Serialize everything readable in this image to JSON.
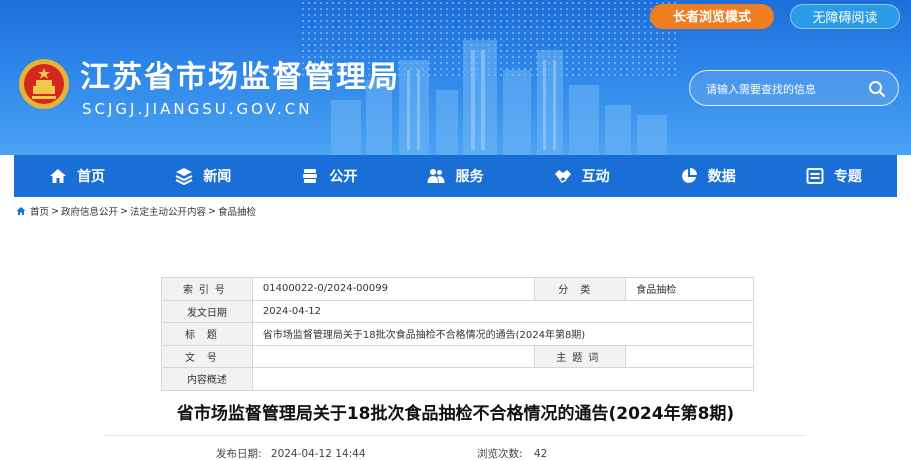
{
  "header": {
    "site_title": "江苏省市场监督管理局",
    "site_domain": "SCJGJ.JIANGSU.GOV.CN",
    "elder_mode_label": "长者浏览模式",
    "accessibility_label": "无障碍阅读",
    "search_placeholder": "请输入需要查找的信息"
  },
  "nav": {
    "items": [
      {
        "label": "首页",
        "icon": "home-icon"
      },
      {
        "label": "新闻",
        "icon": "layers-icon"
      },
      {
        "label": "公开",
        "icon": "stack-icon"
      },
      {
        "label": "服务",
        "icon": "users-icon"
      },
      {
        "label": "互动",
        "icon": "handshake-icon"
      },
      {
        "label": "数据",
        "icon": "pie-chart-icon"
      },
      {
        "label": "专题",
        "icon": "board-icon"
      }
    ]
  },
  "breadcrumb": {
    "items": [
      "首页",
      "政府信息公开",
      "法定主动公开内容",
      "食品抽检"
    ],
    "separator": ">"
  },
  "info_table": {
    "index_label": "索引号",
    "index_value": "01400022-0/2024-00099",
    "category_label": "分类",
    "category_value": "食品抽检",
    "date_label": "发文日期",
    "date_value": "2024-04-12",
    "title_label": "标题",
    "title_value": "省市场监督管理局关于18批次食品抽检不合格情况的通告(2024年第8期)",
    "doc_no_label": "文号",
    "doc_no_value": "",
    "keywords_label": "主题词",
    "keywords_value": "",
    "summary_label": "内容概述",
    "summary_value": ""
  },
  "article": {
    "title": "省市场监督管理局关于18批次食品抽检不合格情况的通告(2024年第8期)",
    "publish_label": "发布日期:",
    "publish_value": "2024-04-12 14:44",
    "views_label": "浏览次数:",
    "views_value": "42"
  },
  "colors": {
    "header_blue": "#2e86ea",
    "nav_blue": "#1a6fd6",
    "elder_orange": "#ef7e22"
  }
}
